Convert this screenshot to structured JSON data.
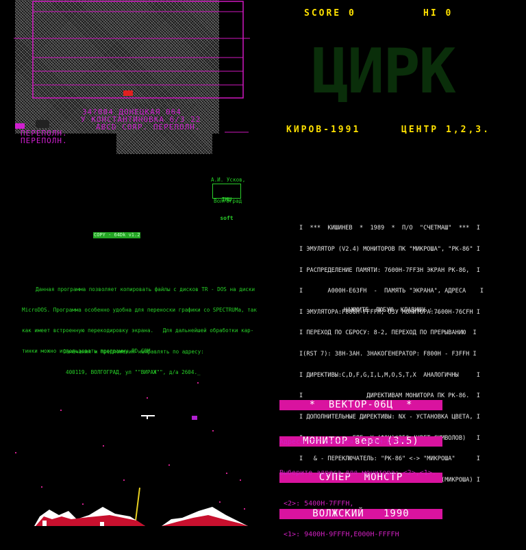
{
  "tl": {
    "address_line1": "34?004 ДОНЕЦКАЯ 064",
    "address_line2": "У КОНСТАНТИНОВКА 6/3 22",
    "address_line3": "ABCD CORP. ПЕРЕПОЛН.",
    "overflow1": "ПЕРЕПОЛН.",
    "overflow2": "ПЕРЕПОЛН."
  },
  "tr": {
    "score_label": "SCORE 0",
    "hi_label": "HI 0",
    "big_title": "ЦИРК",
    "kirov": "КИРОВ-1991",
    "center": "ЦЕНТР 1,2,3."
  },
  "ml": {
    "author": "А.И. Усков,",
    "logo_line1": "IMU",
    "logo_line2": "soft",
    "city": "Волгоград",
    "copy_badge": "COPY - 64Dk v1.2",
    "para": [
      "Данная программа позволяет копировать файлы с дисков TR - DOS на диски",
      "MicroDOS. Программа особенно удобна для переноски графики со SPECTRUMа, так",
      "как имеет встроенную перекодировку экрана.   Для дальнейшей обработки кар-",
      "тинки можно использовать программу PD.COM"
    ],
    "contact": [
      "Замечания и предложения направлять по адресу:",
      "400119, ВОЛГОГРАД, ул \"\"ВИРАЖ\"\", д/а 2604._"
    ]
  },
  "mr": {
    "lines": [
      "I  ***  КИШИНЕВ  *  1989  *  П/О  \"СЧЕТМАШ\"  ***  I",
      "I ЭМУЛЯТОР (V2.4) МОНИТОРОВ ПК \"МИКРОША\", \"РК-86\" I",
      "I РАСПРЕДЕЛЕНИЕ ПАМЯТИ: 7600H-7FF3H ЭКРАН РК-86,  I",
      "I       A000H-E63FH  -  ПАМЯТЬ \"ЭКРАНА\", АДРЕСА    I",
      "I ЭМУЛЯТОРА:F000H-FFFFH; ОЗУ МОНИТОРА:7600H-76CFH I",
      "I ПЕРЕХОД ПО СБРОСУ: 8-2, ПЕРЕХОД ПО ПРЕРЫВАНИЮ  I",
      "I(RST 7): 38H-3AH. ЗНАКОГЕНЕРАТОР: F800H - F3FFH I",
      "I ДИРЕКТИВЫ:C,D,F,G,I,L,M,O,S,T,X  АНАЛОГИЧНЫ     I",
      "I                  ДИРЕКТИВАМ МОНИТОРА ПК РК-86.  I",
      "I ДОПОЛНИТЕЛЬНЫЕ ДИРЕКТИВЫ: NX - УСТАНОВКА ЦВЕТА, I",
      "I              ГДЕ  X=(ФОН)*256+(ЦВЕТ СИМВОЛОВ)   I",
      "I   & - ПЕРЕКЛЮЧАТЕЛЬ: \"РК-86\" <-> \"МИКРОША\"      I",
      "I КОНСТАНТЫ  R/W: F400H (РК-86);  F482H (МИКРОША) I"
    ],
    "prompt": "НАЖМИТЕ  ЛЮБУЮ  КЛАВИШУ : _"
  },
  "br": {
    "title_rows": [
      "*  ВЕКТОР-06Ц  *",
      "МОНИТОР верс (3.5)",
      "СУПЕР  МОНСТР",
      "ВОЛЖСКИЙ   1990"
    ],
    "info": [
      "Адреса ОЗУ дисплея: 4000H-DFFFH.",
      "Выберите адреса для монитора: <2>,<1>.",
      " <2>: 5400H-7FFFH,",
      " <1>: 9400H-9FFFH,E000H-FFFFH"
    ]
  }
}
